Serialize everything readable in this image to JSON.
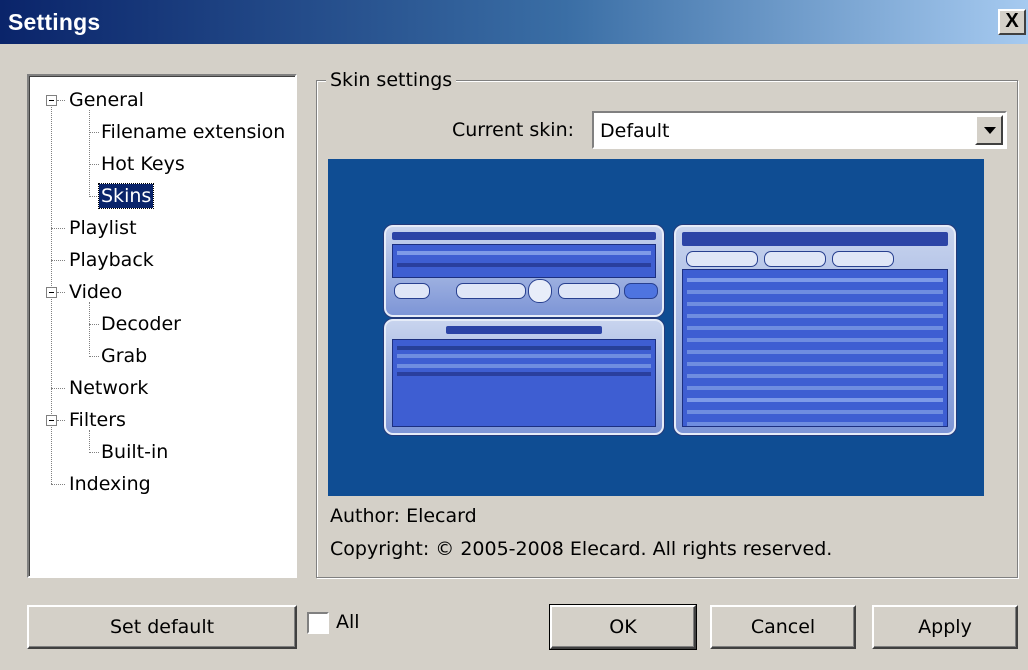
{
  "window": {
    "title": "Settings",
    "close_label": "X"
  },
  "tree": {
    "items": [
      {
        "label": "General",
        "expanded": true
      },
      {
        "label": "Filename extension"
      },
      {
        "label": "Hot Keys"
      },
      {
        "label": "Skins",
        "selected": true
      },
      {
        "label": "Playlist"
      },
      {
        "label": "Playback"
      },
      {
        "label": "Video",
        "expanded": true
      },
      {
        "label": "Decoder"
      },
      {
        "label": "Grab"
      },
      {
        "label": "Network"
      },
      {
        "label": "Filters",
        "expanded": true
      },
      {
        "label": "Built-in"
      },
      {
        "label": "Indexing"
      }
    ]
  },
  "skin": {
    "group_label": "Skin settings",
    "current_skin_label": "Current skin:",
    "current_skin_value": "Default",
    "author": "Author: Elecard",
    "copyright": "Copyright: © 2005-2008 Elecard. All rights reserved."
  },
  "footer": {
    "set_default": "Set default",
    "all_checkbox_label": "All",
    "all_checked": false,
    "ok": "OK",
    "cancel": "Cancel",
    "apply": "Apply"
  },
  "colors": {
    "title_bar": "#0a246a",
    "selection": "#0a246a",
    "preview_bg": "#0f4d93"
  }
}
